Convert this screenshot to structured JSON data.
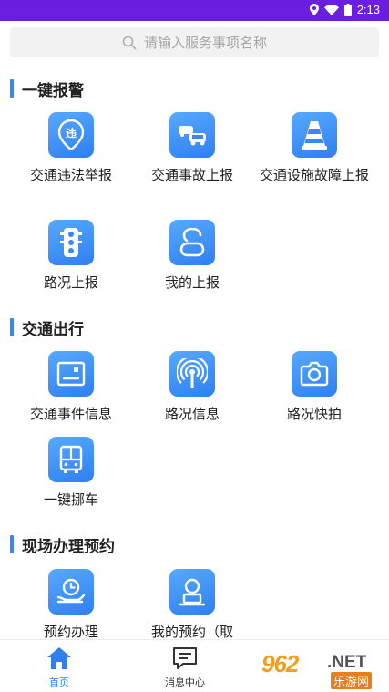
{
  "status_bar": {
    "time": "2:13"
  },
  "search": {
    "placeholder": "请输入服务事项名称"
  },
  "sections": [
    {
      "title": "一键报警",
      "items": [
        {
          "label": "交通违法举报",
          "icon": "violation-report-icon"
        },
        {
          "label": "交通事故上报",
          "icon": "car-accident-icon"
        },
        {
          "label": "交通设施故障上报",
          "icon": "traffic-cone-icon"
        },
        {
          "label": "路况上报",
          "icon": "traffic-light-icon"
        },
        {
          "label": "我的上报",
          "icon": "my-reports-icon"
        }
      ]
    },
    {
      "title": "交通出行",
      "items": [
        {
          "label": "交通事件信息",
          "icon": "event-info-icon"
        },
        {
          "label": "路况信息",
          "icon": "broadcast-icon"
        },
        {
          "label": "路况快拍",
          "icon": "camera-icon"
        },
        {
          "label": "一键挪车",
          "icon": "bus-icon"
        }
      ]
    },
    {
      "title": "现场办理预约",
      "items": [
        {
          "label": "预约办理",
          "icon": "appointment-icon"
        },
        {
          "label": "我的预约（取",
          "icon": "my-appointment-icon"
        }
      ]
    }
  ],
  "tab_bar": [
    {
      "label": "首页",
      "icon": "home-icon",
      "active": true
    },
    {
      "label": "消息中心",
      "icon": "message-icon",
      "active": false
    }
  ],
  "watermark": {
    "main": "962",
    "net": ".NET",
    "sub": "乐游网"
  },
  "colors": {
    "accent": "#2f7ff0",
    "status_bar": "#6a1fe0",
    "section_bar": "#3a86f5"
  }
}
